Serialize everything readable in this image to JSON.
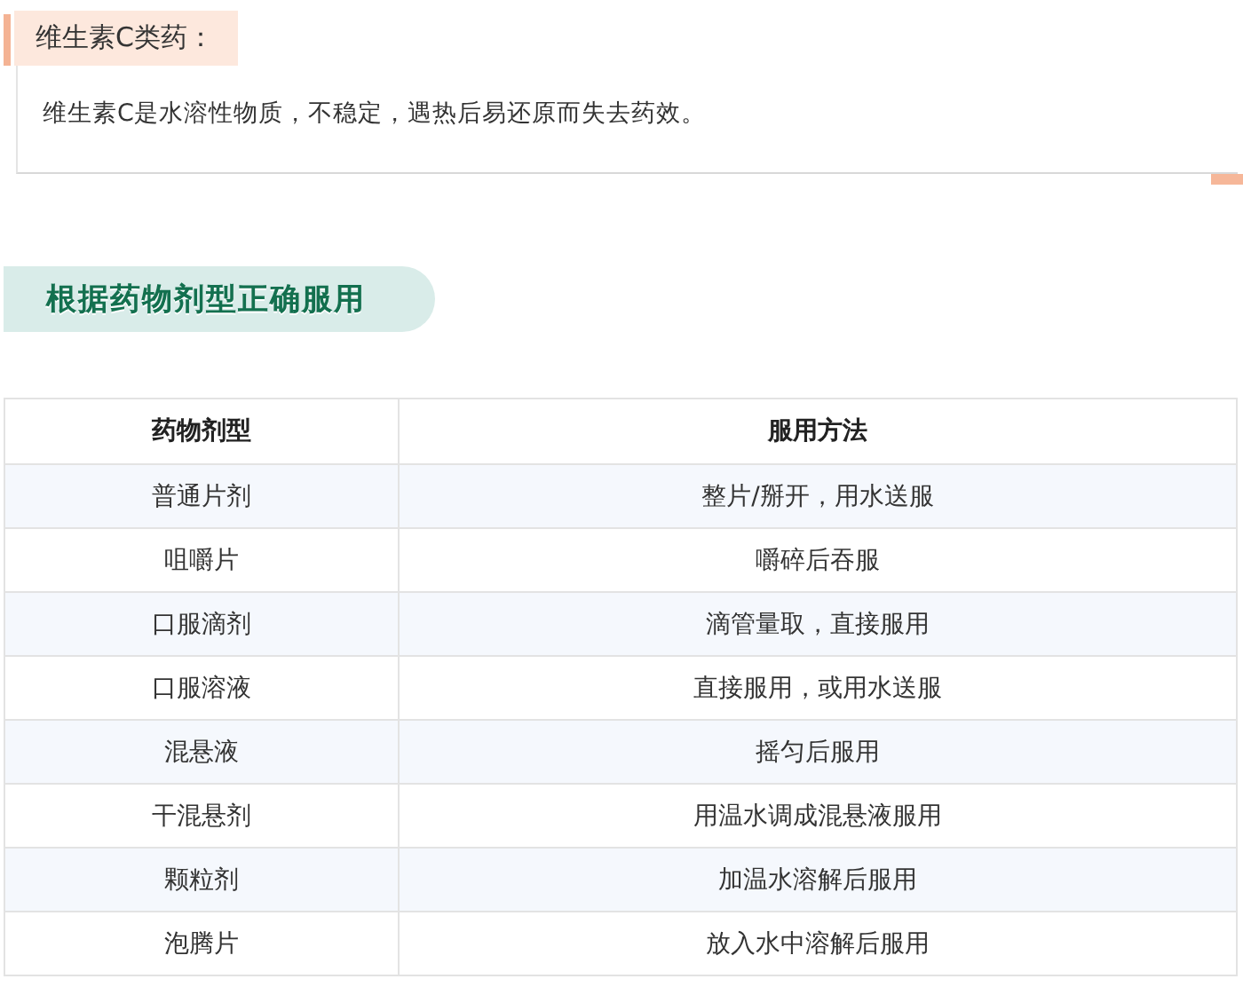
{
  "note_card": {
    "title": "维生素C类药：",
    "text": "维生素C是水溶性物质，不稳定，遇热后易还原而失去药效。"
  },
  "section_banner": {
    "title": "根据药物剂型正确服用"
  },
  "table": {
    "columns": [
      "药物剂型",
      "服用方法"
    ],
    "rows": [
      [
        "普通片剂",
        "整片/掰开，用水送服"
      ],
      [
        "咀嚼片",
        "嚼碎后吞服"
      ],
      [
        "口服滴剂",
        "滴管量取，直接服用"
      ],
      [
        "口服溶液",
        "直接服用，或用水送服"
      ],
      [
        "混悬液",
        "摇匀后服用"
      ],
      [
        "干混悬剂",
        "用温水调成混悬液服用"
      ],
      [
        "颗粒剂",
        "加温水溶解后服用"
      ],
      [
        "泡腾片",
        "放入水中溶解后服用"
      ]
    ]
  }
}
